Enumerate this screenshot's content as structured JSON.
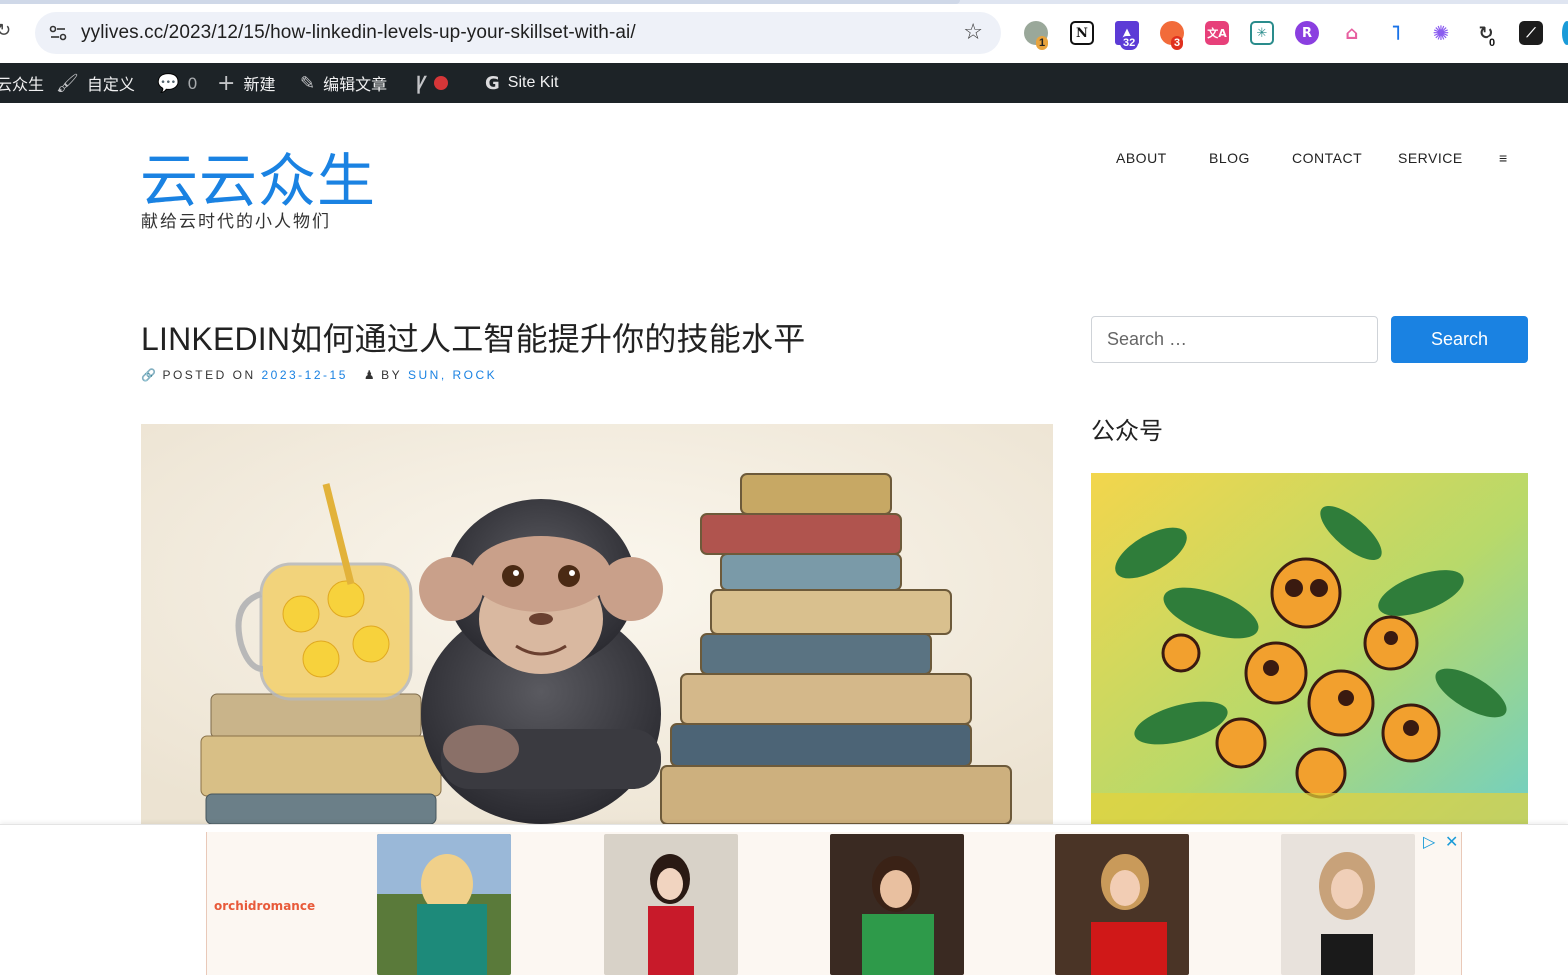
{
  "browser": {
    "url": "yylives.cc/2023/12/15/how-linkedin-levels-up-your-skillset-with-ai/",
    "extensions": [
      {
        "icon": "chrome-ext-icon",
        "badge": "1",
        "color": "#8a9a8a",
        "badge_color": "#e8a33d"
      },
      {
        "icon": "notion-icon",
        "badge": "",
        "color": "#111111"
      },
      {
        "icon": "mortarboard-icon",
        "badge": "32",
        "color": "#5c3bd6",
        "badge_color": "#5c3bd6"
      },
      {
        "icon": "cloud-icon",
        "badge": "3",
        "color": "#f26b3a",
        "badge_color": "#e0301e"
      },
      {
        "icon": "translate-icon",
        "badge": "",
        "color": "#e7407a"
      },
      {
        "icon": "nexus-icon",
        "badge": "",
        "color": "#2a8c8c"
      },
      {
        "icon": "purple-circle-icon",
        "badge": "",
        "color": "#8a3fe0"
      },
      {
        "icon": "hanger-icon",
        "badge": "",
        "color": "#e75fa0"
      },
      {
        "icon": "blue-mark-icon",
        "badge": "",
        "color": "#1a73e8"
      },
      {
        "icon": "openai-icon",
        "badge": "",
        "color": "#8a5cf0"
      },
      {
        "icon": "refresh-ext-icon",
        "badge": "0",
        "color": "#333333",
        "badge_color": "#ffffff"
      },
      {
        "icon": "dark-square-icon",
        "badge": "",
        "color": "#1d1d1d"
      }
    ]
  },
  "adminbar": {
    "site": "云众生",
    "customize": "自定义",
    "comments": "0",
    "new": "新建",
    "edit": "编辑文章",
    "sitekit": "Site Kit"
  },
  "site": {
    "title": "云云众生",
    "description": "献给云时代的小人物们"
  },
  "nav": {
    "items": [
      "ABOUT",
      "BLOG",
      "CONTACT",
      "SERVICE"
    ],
    "menu": "≡"
  },
  "post": {
    "title": "LINKEDIN如何通过人工智能提升你的技能水平",
    "posted_on_label": "POSTED ON",
    "date": "2023-12-15",
    "by_label": "BY",
    "author": "SUN, ROCK"
  },
  "sidebar": {
    "search_placeholder": "Search …",
    "search_button": "Search",
    "widget_title": "公众号"
  },
  "ad": {
    "brand": "orchidromance",
    "adchoices": "▷",
    "close": "✕"
  },
  "colors": {
    "accent": "#1a82e2",
    "adminbar": "#1d2327"
  }
}
